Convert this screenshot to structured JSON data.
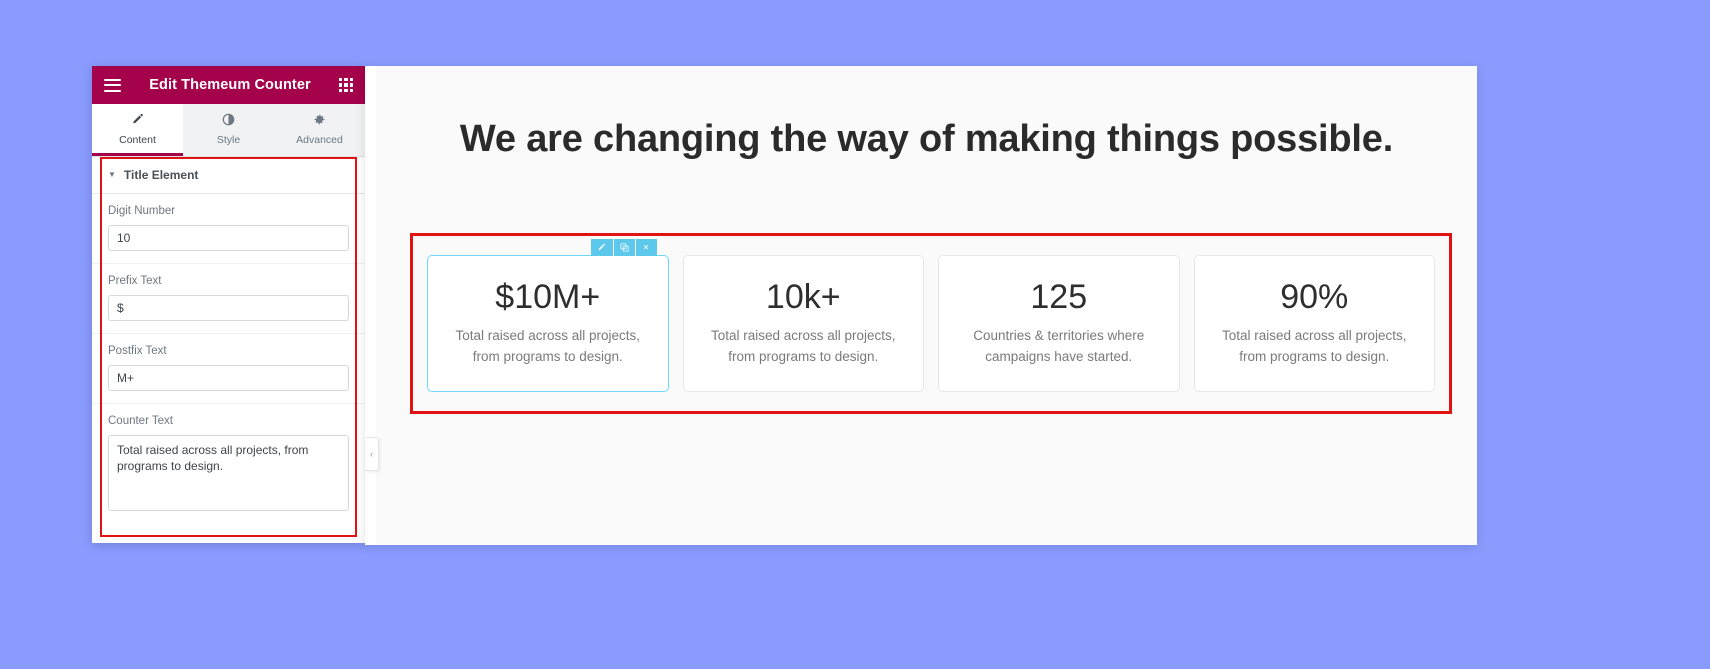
{
  "theme": {
    "panel_header_bg": "#a4024b",
    "accent_red": "#e11212",
    "selection_blue": "#5bc8ec",
    "canvas_bg": "#fafafa",
    "page_bg": "#8a9bff"
  },
  "panel": {
    "header": {
      "title": "Edit Themeum Counter",
      "menu_icon": "hamburger-icon",
      "apps_icon": "grid-icon"
    },
    "tabs": [
      {
        "label": "Content",
        "icon": "pencil-icon",
        "glyph": "✎",
        "active": true
      },
      {
        "label": "Style",
        "icon": "contrast-icon",
        "glyph": "◐",
        "active": false
      },
      {
        "label": "Advanced",
        "icon": "gear-icon",
        "glyph": "⚙",
        "active": false
      }
    ],
    "section": {
      "title": "Title Element",
      "caret_icon": "chevron-down-icon",
      "caret_glyph": "▼",
      "expanded": true
    },
    "fields": [
      {
        "label": "Digit Number",
        "value": "10",
        "type": "text"
      },
      {
        "label": "Prefix Text",
        "value": "$",
        "type": "text"
      },
      {
        "label": "Postfix Text",
        "value": "M+",
        "type": "text"
      },
      {
        "label": "Counter Text",
        "value": "Total raised across all projects, from programs to design.",
        "type": "textarea"
      }
    ],
    "collapse_tab": {
      "icon": "chevron-left-icon",
      "glyph": "‹"
    }
  },
  "preview": {
    "heading": "We are changing the way of making things possible.",
    "element_toolbar": [
      {
        "name": "edit-widget-button",
        "icon": "pencil-icon"
      },
      {
        "name": "duplicate-widget-button",
        "icon": "duplicate-icon"
      },
      {
        "name": "delete-widget-button",
        "icon": "close-icon",
        "glyph": "✕"
      }
    ],
    "counters": [
      {
        "number": "$10M+",
        "text": "Total raised across all projects, from programs to design.",
        "selected": true
      },
      {
        "number": "10k+",
        "text": "Total raised across all projects, from programs to design.",
        "selected": false
      },
      {
        "number": "125",
        "text": "Countries & territories where campaigns have started.",
        "selected": false
      },
      {
        "number": "90%",
        "text": "Total raised across all projects, from programs to design.",
        "selected": false
      }
    ]
  }
}
